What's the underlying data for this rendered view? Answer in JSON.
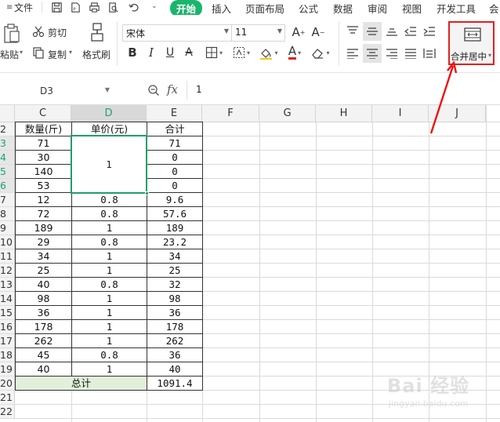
{
  "menubar": {
    "file": "文件",
    "tabs": [
      "开始",
      "插入",
      "页面布局",
      "公式",
      "数据",
      "审阅",
      "视图",
      "开发工具",
      "会"
    ]
  },
  "ribbon": {
    "paste": "粘贴",
    "cut": "剪切",
    "copy": "复制",
    "format_painter": "格式刷",
    "font_name": "宋体",
    "font_size": "11",
    "merge_center": "合并居中"
  },
  "formula_bar": {
    "cell_ref": "D3",
    "fx": "fx",
    "value": "1"
  },
  "columns": [
    "C",
    "D",
    "E",
    "F",
    "G",
    "H",
    "I",
    "J"
  ],
  "selected_column": "D",
  "rows": [
    "2",
    "3",
    "4",
    "5",
    "6",
    "7",
    "8",
    "9",
    "10",
    "11",
    "12",
    "13",
    "14",
    "15",
    "16",
    "17",
    "18",
    "19",
    "20",
    "21",
    "22"
  ],
  "selected_rows": [
    "3",
    "4",
    "5",
    "6"
  ],
  "table": {
    "headers": [
      "数量(斤)",
      "单价(元)",
      "合计"
    ],
    "quantity": [
      "71",
      "30",
      "140",
      "53",
      "12",
      "72",
      "189",
      "29",
      "34",
      "25",
      "40",
      "98",
      "36",
      "178",
      "262",
      "45",
      "40"
    ],
    "price_merged": "1",
    "price": [
      "0.8",
      "0.8",
      "1",
      "0.8",
      "1",
      "1",
      "0.8",
      "1",
      "1",
      "1",
      "1",
      "0.8",
      "1"
    ],
    "total": [
      "71",
      "0",
      "0",
      "0",
      "9.6",
      "57.6",
      "189",
      "23.2",
      "34",
      "25",
      "32",
      "98",
      "36",
      "178",
      "262",
      "36",
      "40"
    ],
    "total_label": "总计",
    "grand_total": "1091.4"
  },
  "watermark": {
    "logo": "Bai 经验",
    "url": "jingyan.baidu.com"
  },
  "colors": {
    "accent_green": "#19b56c",
    "selection_green": "#1f9e6a",
    "highlight_red": "#e02020",
    "total_row_bg": "#e2efda"
  }
}
